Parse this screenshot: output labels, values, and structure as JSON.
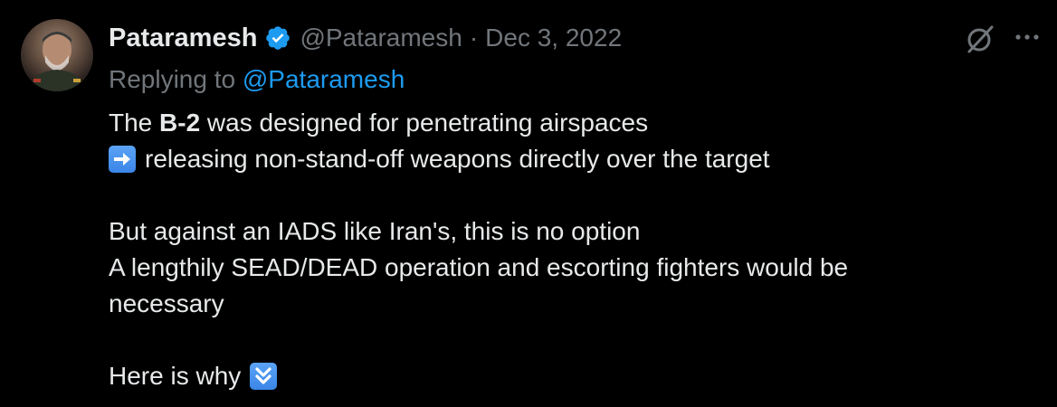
{
  "tweet": {
    "display_name": "Pataramesh",
    "display_name_visible": "Pataramesh",
    "handle": "@Pataramesh",
    "separator": "·",
    "date": "Dec 3, 2022",
    "reply_prefix": "Replying to",
    "reply_mention": "@Pataramesh",
    "lines": {
      "l1_pre": "The ",
      "l1_bold": "B-2",
      "l1_post": " was designed for penetrating airspaces",
      "l2": "releasing non-stand-off weapons directly over the target",
      "l3": "But against an IADS like Iran's, this is no option",
      "l4": "A lengthily SEAD/DEAD operation and escorting fighters would be",
      "l5": "necessary",
      "l6": "Here is why"
    }
  },
  "icons": {
    "verified": "verified-badge-icon",
    "grok": "grok-icon",
    "more": "more-icon",
    "arrow_right": "right-arrow-emoji-icon",
    "double_down": "double-down-arrow-emoji-icon"
  },
  "colors": {
    "background": "#000000",
    "text": "#e7e9ea",
    "muted": "#71767b",
    "accent": "#1d9bf0"
  }
}
